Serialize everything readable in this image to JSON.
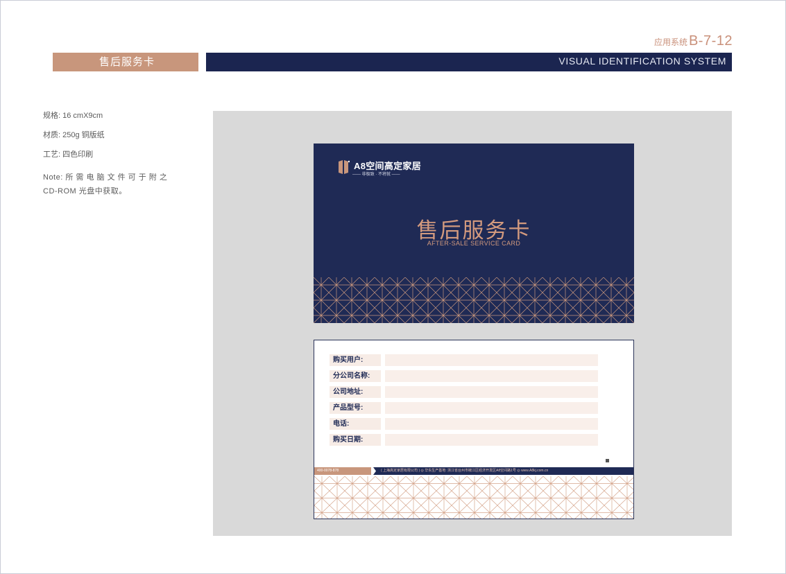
{
  "header": {
    "system_label": "应用系统",
    "system_code": "B-7-12",
    "section_title": "售后服务卡",
    "vis_system": "VISUAL  IDENTIFICATION  SYSTEM"
  },
  "specs": {
    "size": "规格: 16 cmX9cm",
    "material": "材质: 250g 铜版纸",
    "process": "工艺: 四色印刷",
    "note": "Note: 所 需 电 脑 文 件 可 于 附 之 CD-ROM 光盘中获取。"
  },
  "card_front": {
    "brand_name": "A8空间高定家居",
    "brand_tagline": "—— 非极致 · 不将就 ——",
    "title": "售后服务卡",
    "subtitle": "AFTER-SALE SERVICE CARD"
  },
  "card_back": {
    "fields": [
      {
        "label": "购买用户:"
      },
      {
        "label": "分公司名称:"
      },
      {
        "label": "公司地址:"
      },
      {
        "label": "产品型号:"
      },
      {
        "label": "电话:"
      },
      {
        "label": "购买日期:"
      }
    ],
    "footer": {
      "phone": "400-0078-878",
      "info": "( 上海高定家居有限公司 )   ◎ 华东生产基地: 浙江省台州市椒江区经济开发区A8空间路1号   ◎ www.A8kj.com.cn"
    }
  },
  "colors": {
    "navy": "#1f2a55",
    "copper": "#c8967c",
    "panel_gray": "#d9d9d9"
  }
}
